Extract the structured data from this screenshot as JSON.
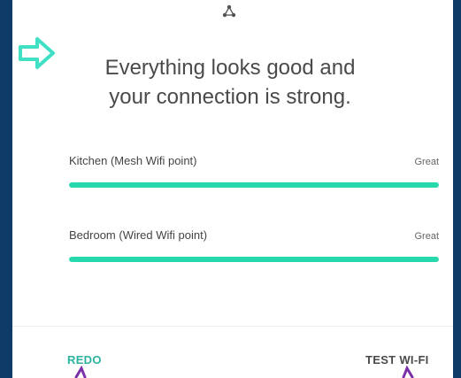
{
  "icons": {
    "mesh": "mesh-network-icon",
    "arrow": "right-arrow-icon",
    "pointer_left": "purple-annotation-arrow-icon",
    "pointer_right": "purple-annotation-arrow-icon"
  },
  "headline": {
    "line1": "Everything looks good and",
    "line2": "your connection is strong."
  },
  "points": [
    {
      "label": "Kitchen (Mesh Wifi point)",
      "status": "Great",
      "signal": 1.0
    },
    {
      "label": "Bedroom (Wired Wifi point)",
      "status": "Great",
      "signal": 1.0
    }
  ],
  "actions": {
    "redo_label": "REDO",
    "test_label": "TEST WI-FI"
  },
  "colors": {
    "accent": "#25d9ac",
    "redo": "#2bb3a0",
    "frame": "#0d3a66",
    "annotation_arrow": "#3fe0c4",
    "annotation_pointer": "#7b2fa8"
  }
}
